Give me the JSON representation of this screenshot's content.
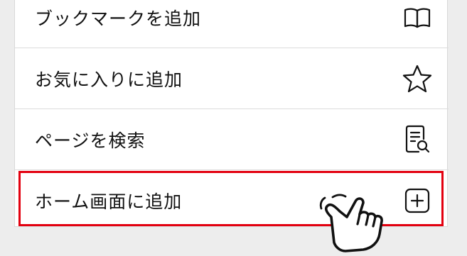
{
  "menu": {
    "items": [
      {
        "label": "ブックマークを追加",
        "icon": "book-icon"
      },
      {
        "label": "お気に入りに追加",
        "icon": "star-icon"
      },
      {
        "label": "ページを検索",
        "icon": "search-page-icon"
      },
      {
        "label": "ホーム画面に追加",
        "icon": "add-square-icon"
      }
    ]
  },
  "colors": {
    "highlight": "#e3000f",
    "background": "#ededed",
    "panel": "#ffffff"
  },
  "annotation": {
    "pointer_icon": "hand-pointer-icon"
  }
}
